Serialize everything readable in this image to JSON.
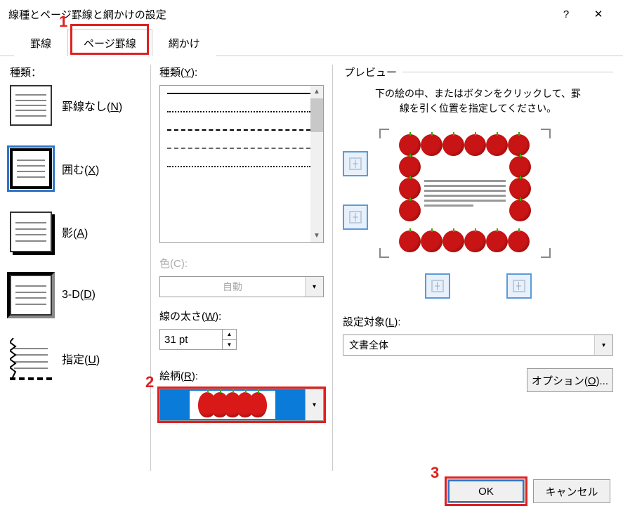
{
  "title": "線種とページ罫線と網かけの設定",
  "titlebar": {
    "help": "?",
    "close": "✕"
  },
  "tabs": [
    {
      "label": "罫線"
    },
    {
      "label": "ページ罫線"
    },
    {
      "label": "網かけ"
    }
  ],
  "callouts": {
    "tab": "1",
    "art": "2",
    "ok": "3"
  },
  "left": {
    "heading": "種類：",
    "settings": [
      {
        "label_pre": "罫線なし(",
        "mn": "N",
        "label_post": ")"
      },
      {
        "label_pre": "囲む(",
        "mn": "X",
        "label_post": ")"
      },
      {
        "label_pre": "影(",
        "mn": "A",
        "label_post": ")"
      },
      {
        "label_pre": "3-D(",
        "mn": "D",
        "label_post": ")"
      },
      {
        "label_pre": "指定(",
        "mn": "U",
        "label_post": ")"
      }
    ]
  },
  "mid": {
    "style_label_pre": "種類(",
    "style_mn": "Y",
    "style_label_post": "):",
    "color_label_pre": "色(",
    "color_mn": "C",
    "color_label_post": "):",
    "color_value": "自動",
    "width_label_pre": "線の太さ(",
    "width_mn": "W",
    "width_label_post": "):",
    "width_value": "31 pt",
    "art_label_pre": "絵柄(",
    "art_mn": "R",
    "art_label_post": "):"
  },
  "right": {
    "preview_label": "プレビュー",
    "hint": "下の絵の中、またはボタンをクリックして、罫線を引く位置を指定してください。",
    "apply_label_pre": "設定対象(",
    "apply_mn": "L",
    "apply_label_post": "):",
    "apply_value": "文書全体",
    "options_pre": "オプション(",
    "options_mn": "O",
    "options_post": ")..."
  },
  "footer": {
    "ok": "OK",
    "cancel": "キャンセル"
  }
}
